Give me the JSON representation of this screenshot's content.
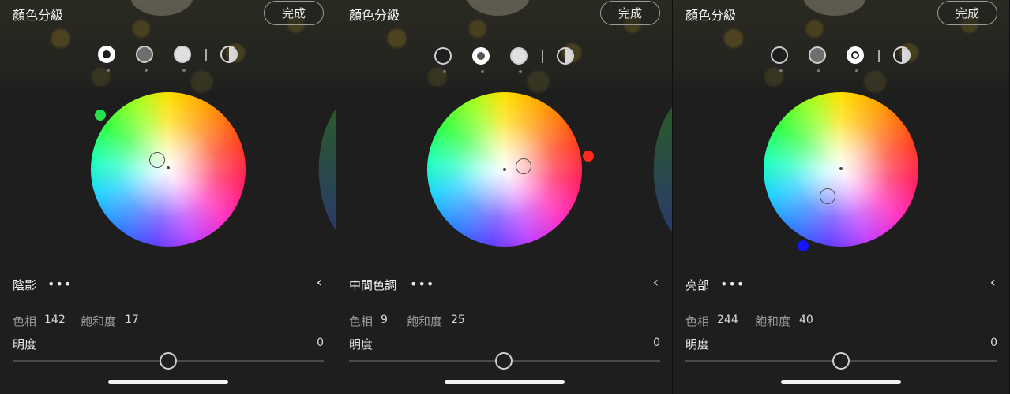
{
  "panels": [
    {
      "title": "顏色分級",
      "done_label": "完成",
      "active_mode": "shadows",
      "section_title": "陰影",
      "more_label": "•••",
      "collapse_label": "‹",
      "hue_label": "色相",
      "hue_value": "142",
      "sat_label": "飽和度",
      "sat_value": "17",
      "lum_label": "明度",
      "lum_value": "0",
      "hue_color": "#27e24c"
    },
    {
      "title": "顏色分級",
      "done_label": "完成",
      "active_mode": "midtones",
      "section_title": "中間色調",
      "more_label": "•••",
      "collapse_label": "‹",
      "hue_label": "色相",
      "hue_value": "9",
      "sat_label": "飽和度",
      "sat_value": "25",
      "lum_label": "明度",
      "lum_value": "0",
      "hue_color": "#ff2a1a"
    },
    {
      "title": "顏色分級",
      "done_label": "完成",
      "active_mode": "highlights",
      "section_title": "亮部",
      "more_label": "•••",
      "collapse_label": "‹",
      "hue_label": "色相",
      "hue_value": "244",
      "sat_label": "飽和度",
      "sat_value": "40",
      "lum_label": "明度",
      "lum_value": "0",
      "hue_color": "#1414ff"
    }
  ]
}
